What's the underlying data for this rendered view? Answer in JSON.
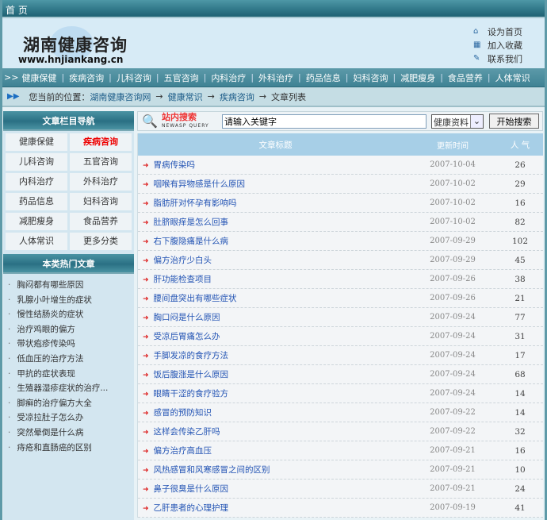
{
  "topbar": {
    "title": "首 页"
  },
  "header": {
    "logo_text": "湖南健康咨询",
    "logo_url": "www.hnjiankang.cn",
    "links": [
      {
        "icon": "home-icon",
        "label": "设为首页"
      },
      {
        "icon": "gift-icon",
        "label": "加入收藏"
      },
      {
        "icon": "edit-icon",
        "label": "联系我们"
      }
    ]
  },
  "nav": {
    "prefix": ">>",
    "items": [
      "健康保健",
      "疾病咨询",
      "儿科咨询",
      "五官咨询",
      "内科治疗",
      "外科治疗",
      "药品信息",
      "妇科咨询",
      "减肥瘦身",
      "食品营养",
      "人体常识"
    ]
  },
  "breadcrumb": {
    "label": "您当前的位置：",
    "items": [
      "湖南健康咨询网",
      "健康常识",
      "疾病咨询"
    ],
    "current": "文章列表",
    "sep": "→"
  },
  "sidebar": {
    "nav_title": "文章栏目导航",
    "categories": [
      "健康保健",
      "疾病咨询",
      "儿科咨询",
      "五官咨询",
      "内科治疗",
      "外科治疗",
      "药品信息",
      "妇科咨询",
      "减肥瘦身",
      "食品营养",
      "人体常识",
      "更多分类"
    ],
    "active": "疾病咨询",
    "hot_title": "本类热门文章",
    "hot": [
      "胸闷都有哪些原因",
      "乳腺小叶增生的症状",
      "慢性结肠炎的症状",
      "治疗鸡眼的偏方",
      "带状疱疹传染吗",
      "低血压的治疗方法",
      "甲抗的症状表现",
      "生殖器湿疹症状的治疗...",
      "脚癣的治疗偏方大全",
      "受凉拉肚子怎么办",
      "突然晕倒是什么病",
      "痔疮和直肠癌的区别"
    ]
  },
  "search": {
    "title": "站内搜索",
    "subtitle": "NEWASP QUERY",
    "placeholder": "请输入关键字",
    "select": "健康资料",
    "button": "开始搜索"
  },
  "table": {
    "headers": [
      "文章标题",
      "更新时间",
      "人 气"
    ],
    "rows": [
      [
        "胃病传染吗",
        "2007-10-04",
        "26"
      ],
      [
        "咽喉有异物感是什么原因",
        "2007-10-02",
        "29"
      ],
      [
        "脂肪肝对怀孕有影响吗",
        "2007-10-02",
        "16"
      ],
      [
        "肚脐眼痒是怎么回事",
        "2007-10-02",
        "82"
      ],
      [
        "右下腹隐痛是什么病",
        "2007-09-29",
        "102"
      ],
      [
        "偏方治疗少白头",
        "2007-09-29",
        "45"
      ],
      [
        "肝功能检查项目",
        "2007-09-26",
        "38"
      ],
      [
        "腰间盘突出有哪些症状",
        "2007-09-26",
        "21"
      ],
      [
        "胸口闷是什么原因",
        "2007-09-24",
        "77"
      ],
      [
        "受凉后胃痛怎么办",
        "2007-09-24",
        "31"
      ],
      [
        "手脚发凉的食疗方法",
        "2007-09-24",
        "17"
      ],
      [
        "饭后腹涨是什么原因",
        "2007-09-24",
        "68"
      ],
      [
        "眼睛干涩的食疗验方",
        "2007-09-24",
        "14"
      ],
      [
        "感冒的预防知识",
        "2007-09-22",
        "14"
      ],
      [
        "这样会传染乙肝吗",
        "2007-09-22",
        "32"
      ],
      [
        "偏方治疗高血压",
        "2007-09-21",
        "16"
      ],
      [
        "风热感冒和风寒感冒之间的区别",
        "2007-09-21",
        "10"
      ],
      [
        "鼻子很臭是什么原因",
        "2007-09-21",
        "24"
      ],
      [
        "乙肝患者的心理护理",
        "2007-09-19",
        "41"
      ]
    ]
  }
}
